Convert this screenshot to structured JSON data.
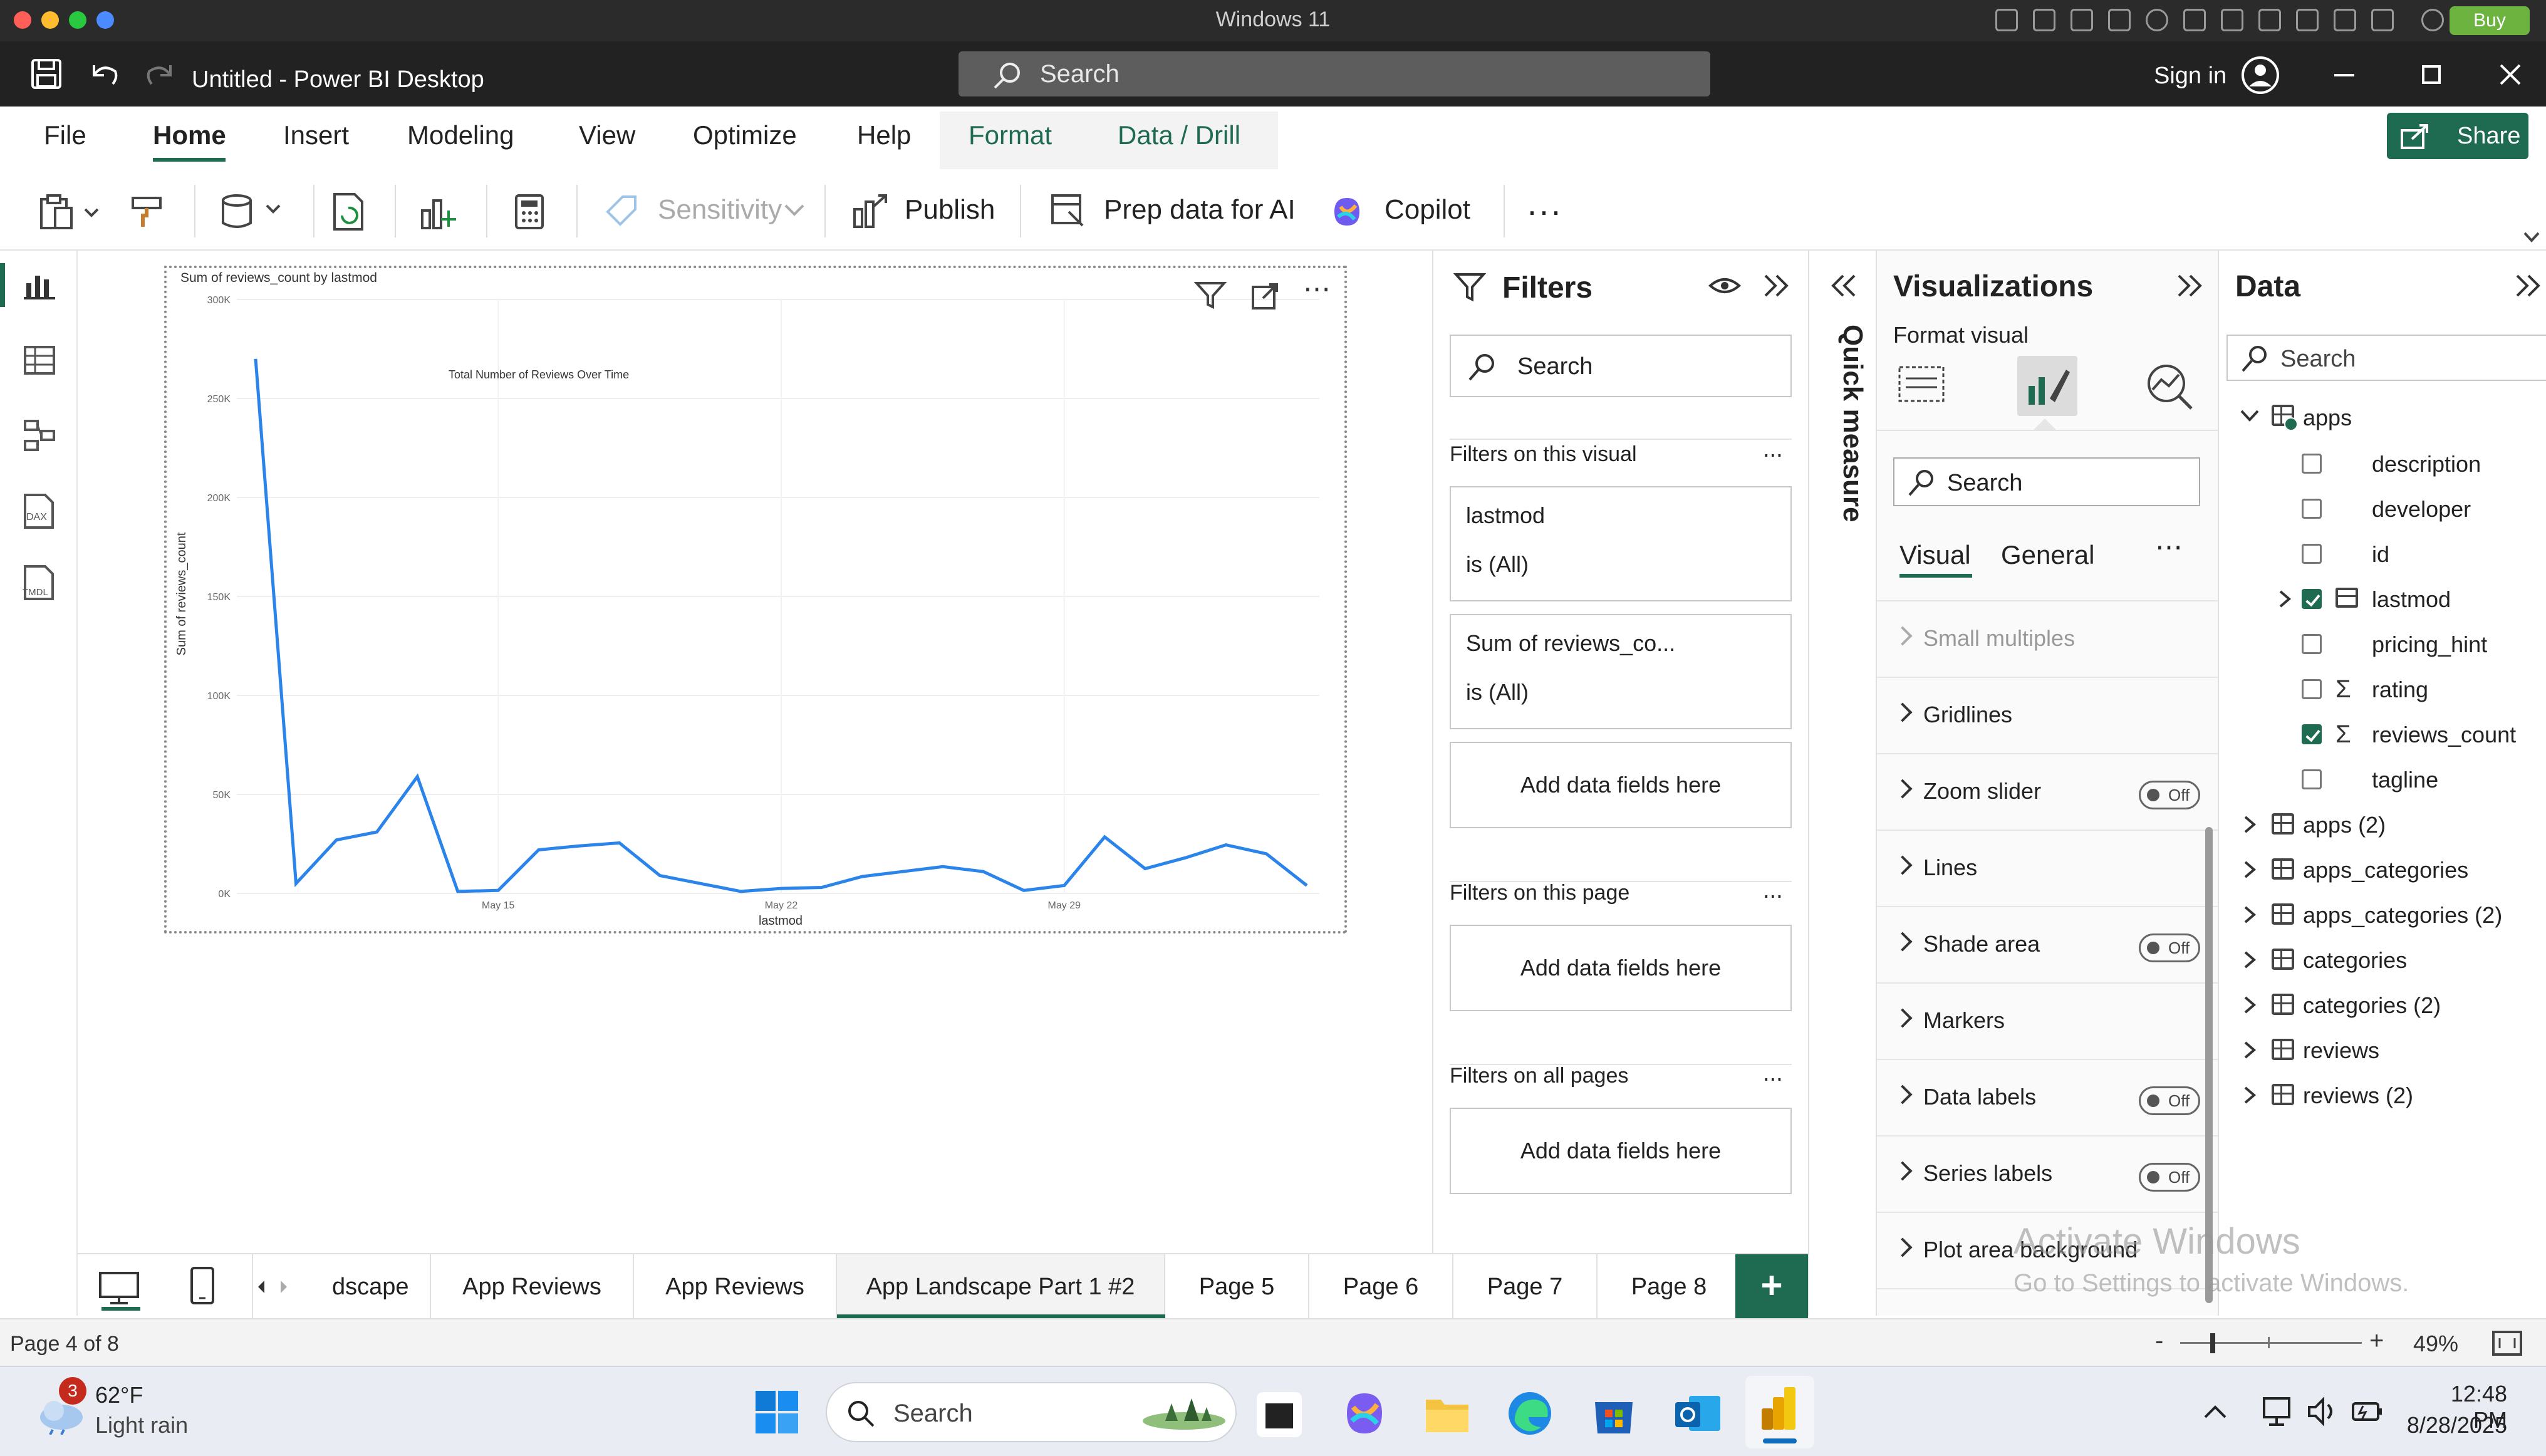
{
  "mac": {
    "title": "Windows 11",
    "buy_label": "Buy"
  },
  "titlebar": {
    "doc_title": "Untitled - Power BI Desktop",
    "search_placeholder": "Search",
    "signin_label": "Sign in"
  },
  "tabs": {
    "items": [
      "File",
      "Home",
      "Insert",
      "Modeling",
      "View",
      "Optimize",
      "Help",
      "Format",
      "Data / Drill"
    ],
    "share_label": "Share"
  },
  "ribbon": {
    "sensitivity_label": "Sensitivity",
    "publish_label": "Publish",
    "prep_label": "Prep data for AI",
    "copilot_label": "Copilot",
    "more_label": "..."
  },
  "chart_data": {
    "type": "line",
    "title": "Sum of reviews_count by lastmod",
    "annotation": "Total Number of Reviews Over Time",
    "xlabel": "lastmod",
    "ylabel": "Sum of reviews_count",
    "ylim": [
      0,
      300000
    ],
    "y_ticks": [
      "300K",
      "250K",
      "200K",
      "150K",
      "100K",
      "50K",
      "0K"
    ],
    "x_ticks": [
      "May 15",
      "May 22",
      "May 29"
    ],
    "series": [
      {
        "values": [
          270000,
          5000,
          27000,
          31000,
          59000,
          1000,
          1500,
          22000,
          24000,
          25500,
          9000,
          5000,
          1000,
          2500,
          3000,
          8500,
          11000,
          13500,
          11000,
          1500,
          4000,
          28500,
          12500,
          18000,
          24500,
          20000,
          4000
        ]
      }
    ],
    "grid": true,
    "color": "#2b84ea"
  },
  "filters": {
    "title": "Filters",
    "search_placeholder": "Search",
    "on_visual": "Filters on this visual",
    "card1_field": "lastmod",
    "card1_value": "is (All)",
    "card2_field": "Sum of reviews_co...",
    "card2_value": "is (All)",
    "add_fields": "Add data fields here",
    "on_page": "Filters on this page",
    "on_all": "Filters on all pages",
    "more": "..."
  },
  "quick_measure": "Quick measure",
  "viz": {
    "title": "Visualizations",
    "format_visual": "Format visual",
    "search_placeholder": "Search",
    "tab_visual": "Visual",
    "tab_general": "General",
    "sections": [
      {
        "label": "Small multiples",
        "toggle": ""
      },
      {
        "label": "Gridlines",
        "toggle": ""
      },
      {
        "label": "Zoom slider",
        "toggle": "Off"
      },
      {
        "label": "Lines",
        "toggle": ""
      },
      {
        "label": "Shade area",
        "toggle": "Off"
      },
      {
        "label": "Markers",
        "toggle": ""
      },
      {
        "label": "Data labels",
        "toggle": "Off"
      },
      {
        "label": "Series labels",
        "toggle": "Off"
      },
      {
        "label": "Plot area background",
        "toggle": ""
      }
    ]
  },
  "data_pane": {
    "title": "Data",
    "search_placeholder": "Search",
    "table_name": "apps",
    "fields": [
      {
        "name": "description",
        "checked": false,
        "kind": "text"
      },
      {
        "name": "developer",
        "checked": false,
        "kind": "text"
      },
      {
        "name": "id",
        "checked": false,
        "kind": "text"
      },
      {
        "name": "lastmod",
        "checked": true,
        "kind": "date"
      },
      {
        "name": "pricing_hint",
        "checked": false,
        "kind": "text"
      },
      {
        "name": "rating",
        "checked": false,
        "kind": "sum"
      },
      {
        "name": "reviews_count",
        "checked": true,
        "kind": "sum"
      },
      {
        "name": "tagline",
        "checked": false,
        "kind": "text"
      }
    ],
    "tables": [
      "apps (2)",
      "apps_categories",
      "apps_categories (2)",
      "categories",
      "categories (2)",
      "reviews",
      "reviews (2)"
    ]
  },
  "pages": {
    "items": [
      "dscape",
      "App Reviews",
      "App Reviews",
      "App Landscape Part 1 #2",
      "Page 5",
      "Page 6",
      "Page 7",
      "Page 8"
    ],
    "active": "App Landscape Part 1 #2",
    "add": "+"
  },
  "status": {
    "page_info": "Page 4 of 8",
    "zoom": "49%",
    "minus": "-",
    "plus": "+"
  },
  "watermark": {
    "line1": "Activate Windows",
    "line2": "Go to Settings to activate Windows."
  },
  "taskbar": {
    "weather_temp": "62°F",
    "weather_desc": "Light rain",
    "weather_badge": "3",
    "search_placeholder": "Search",
    "time": "12:48 PM",
    "date": "8/28/2025"
  }
}
